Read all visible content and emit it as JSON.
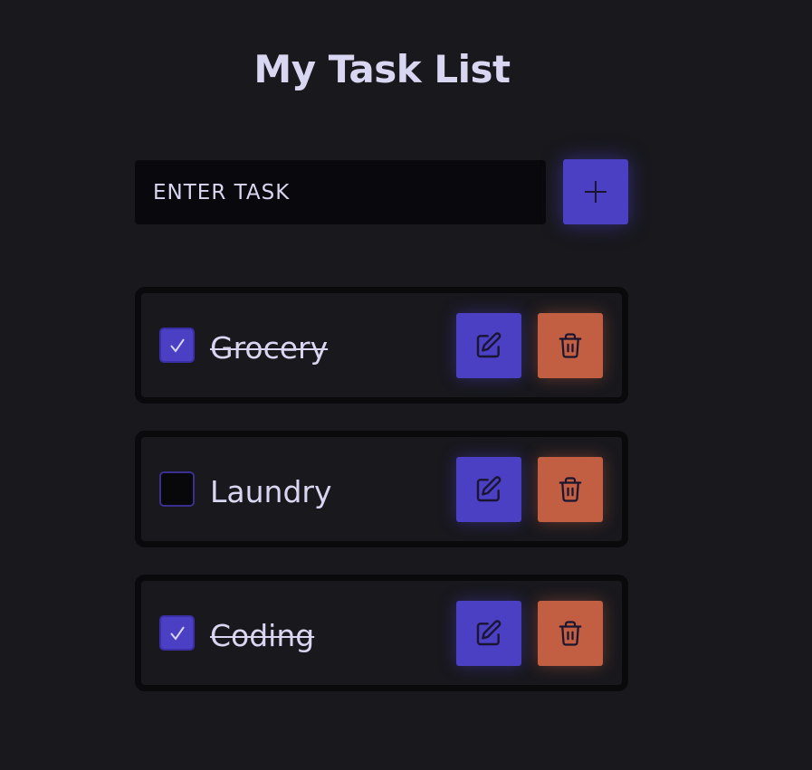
{
  "app": {
    "title": "My Task List"
  },
  "new_task": {
    "placeholder": "ENTER TASK",
    "value": "",
    "add_icon": "plus-icon"
  },
  "tasks": [
    {
      "label": "Grocery",
      "completed": true
    },
    {
      "label": "Laundry",
      "completed": false
    },
    {
      "label": "Coding",
      "completed": true
    }
  ],
  "icons": {
    "check": "check-icon",
    "edit": "pencil-square-icon",
    "delete": "trash-icon"
  },
  "colors": {
    "background": "#18181d",
    "input_background": "#09090d",
    "accent": "#4b3fc4",
    "danger": "#c25f42",
    "text": "#d8d6f0",
    "card_border": "#0a0a0d"
  }
}
